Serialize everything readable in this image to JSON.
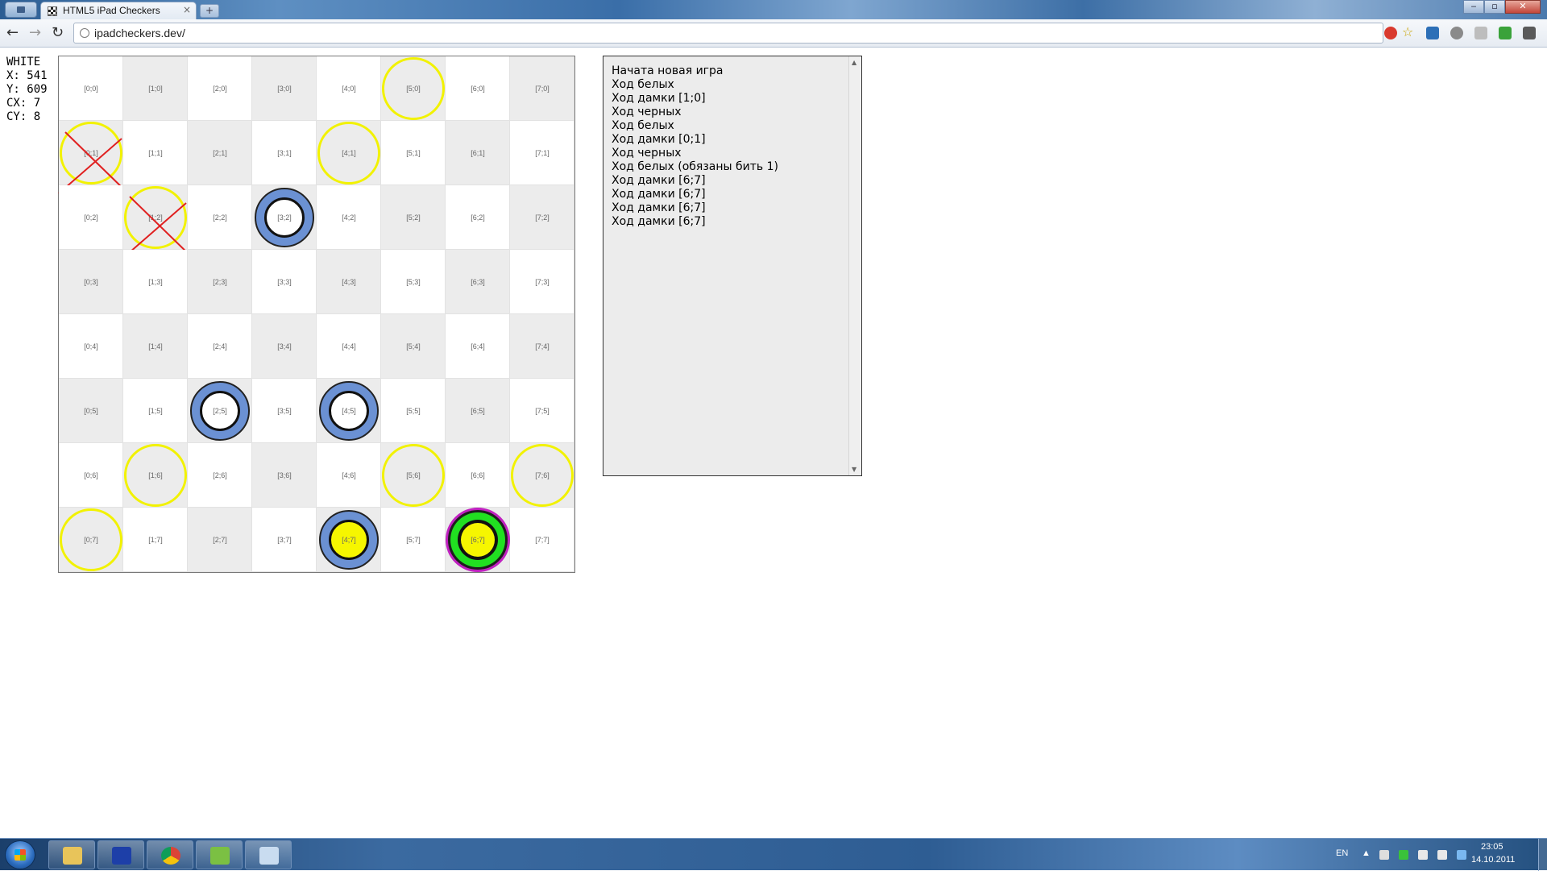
{
  "browser": {
    "tab_title": "HTML5 iPad Checkers",
    "tab_close": "×",
    "new_tab": "+",
    "url": "ipadcheckers.dev/",
    "back_icon": "back-arrow-icon",
    "forward_icon": "forward-arrow-icon",
    "reload_icon": "reload-icon",
    "win_min": "‒",
    "win_max": "▫",
    "win_close": "✕"
  },
  "info": {
    "player": "WHITE",
    "x": "X: 541",
    "y": "Y: 609",
    "cx": "CX: 7",
    "cy": "CY: 8"
  },
  "board": {
    "size": 8,
    "labels": [
      [
        "[0;0]",
        "[1;0]",
        "[2;0]",
        "[3;0]",
        "[4;0]",
        "[5;0]",
        "[6;0]",
        "[7;0]"
      ],
      [
        "[0;1]",
        "[1;1]",
        "[2;1]",
        "[3;1]",
        "[4;1]",
        "[5;1]",
        "[6;1]",
        "[7;1]"
      ],
      [
        "[0;2]",
        "[1;2]",
        "[2;2]",
        "[3;2]",
        "[4;2]",
        "[5;2]",
        "[6;2]",
        "[7;2]"
      ],
      [
        "[0;3]",
        "[1;3]",
        "[2;3]",
        "[3;3]",
        "[4;3]",
        "[5;3]",
        "[6;3]",
        "[7;3]"
      ],
      [
        "[0;4]",
        "[1;4]",
        "[2;4]",
        "[3;4]",
        "[4;4]",
        "[5;4]",
        "[6;4]",
        "[7;4]"
      ],
      [
        "[0;5]",
        "[1;5]",
        "[2;5]",
        "[3;5]",
        "[4;5]",
        "[5;5]",
        "[6;5]",
        "[7;5]"
      ],
      [
        "[0;6]",
        "[1;6]",
        "[2;6]",
        "[3;6]",
        "[4;6]",
        "[5;6]",
        "[6;6]",
        "[7;6]"
      ],
      [
        "[0;7]",
        "[1;7]",
        "[2;7]",
        "[3;7]",
        "[4;7]",
        "[5;7]",
        "[6;7]",
        "[7;7]"
      ]
    ],
    "yellow_rings": [
      [
        5,
        0
      ],
      [
        0,
        1
      ],
      [
        4,
        1
      ],
      [
        1,
        2
      ],
      [
        1,
        6
      ],
      [
        5,
        6
      ],
      [
        7,
        6
      ],
      [
        0,
        7
      ]
    ],
    "crossed": [
      [
        0,
        1
      ],
      [
        1,
        2
      ]
    ],
    "blue_pieces": [
      [
        3,
        2
      ],
      [
        2,
        5
      ],
      [
        4,
        5
      ]
    ],
    "blue_king": [
      [
        4,
        7
      ]
    ],
    "selected_piece": [
      [
        6,
        7
      ]
    ],
    "colors": {
      "dark_cell": "#ececec",
      "light_cell": "#ffffff",
      "ring": "#f2f200",
      "piece": "#6b91d3",
      "selected_ring": "#c021c0",
      "selected_fill": "#21e021",
      "cross": "#e02020"
    }
  },
  "log": {
    "lines": [
      "Начата новая игра",
      "Ход белых",
      "Ход дамки [1;0]",
      "Ход черных",
      "Ход белых",
      "Ход дамки [0;1]",
      "Ход черных",
      "Ход белых (обязаны бить 1)",
      "Ход дамки [6;7]",
      "Ход дамки [6;7]",
      "Ход дамки [6;7]",
      "Ход дамки [6;7]"
    ]
  },
  "taskbar": {
    "lang": "EN",
    "time": "23:05",
    "date": "14.10.2011",
    "pinned": [
      "folder-icon",
      "floppy-save-icon",
      "chrome-icon",
      "notepad-icon",
      "cube-icon"
    ]
  }
}
